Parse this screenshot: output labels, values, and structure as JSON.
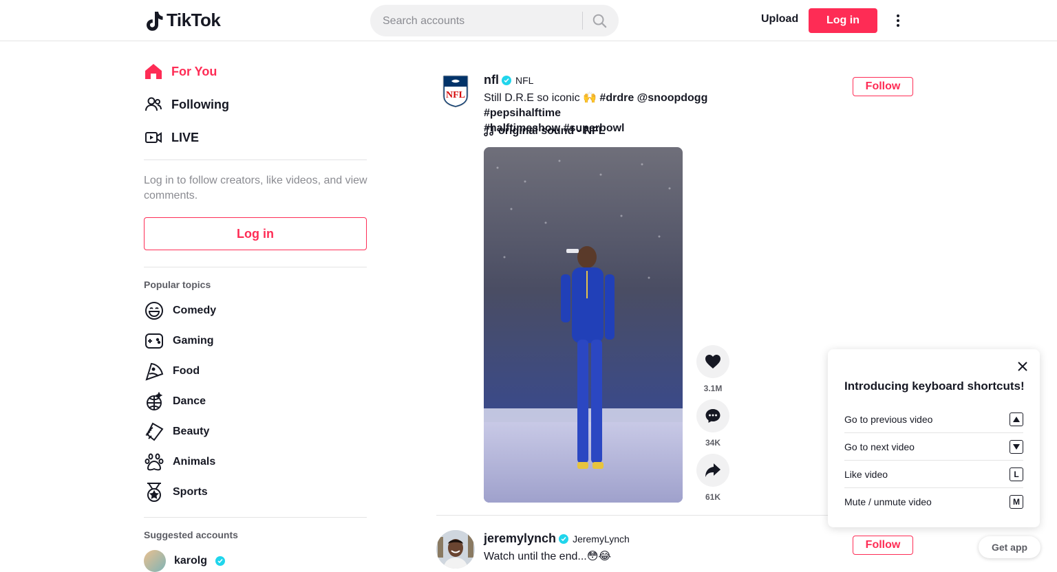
{
  "header": {
    "logo_text": "TikTok",
    "search_placeholder": "Search accounts",
    "upload_label": "Upload",
    "login_label": "Log in"
  },
  "sidebar": {
    "nav": [
      {
        "label": "For You",
        "icon": "home-icon",
        "active": true
      },
      {
        "label": "Following",
        "icon": "users-icon",
        "active": false
      },
      {
        "label": "LIVE",
        "icon": "live-camera-icon",
        "active": false
      }
    ],
    "login_hint": "Log in to follow creators, like videos, and view comments.",
    "login_button": "Log in",
    "popular_topics_title": "Popular topics",
    "topics": [
      {
        "label": "Comedy",
        "icon": "laugh-icon"
      },
      {
        "label": "Gaming",
        "icon": "gamepad-icon"
      },
      {
        "label": "Food",
        "icon": "pizza-icon"
      },
      {
        "label": "Dance",
        "icon": "disco-ball-icon"
      },
      {
        "label": "Beauty",
        "icon": "comb-icon"
      },
      {
        "label": "Animals",
        "icon": "paw-icon"
      },
      {
        "label": "Sports",
        "icon": "medal-icon"
      }
    ],
    "suggested_title": "Suggested accounts",
    "suggested": [
      {
        "name": "karolg",
        "verified": true
      }
    ]
  },
  "feed": {
    "posts": [
      {
        "username": "nfl",
        "nickname": "NFL",
        "verified": true,
        "caption_text": "Still D.R.E so iconic 🙌",
        "tags_line1": "#drdre @snoopdogg #pepsihalftime",
        "tags_line2": "#halftimeshow #superbowl",
        "sound": "original sound - NFL",
        "follow_label": "Follow",
        "likes": "3.1M",
        "comments": "34K",
        "shares": "61K"
      },
      {
        "username": "jeremylynch",
        "nickname": "JeremyLynch",
        "verified": true,
        "caption_text": "Watch until the end...😳😂",
        "follow_label": "Follow"
      }
    ]
  },
  "shortcuts_popup": {
    "title": "Introducing keyboard shortcuts!",
    "rows": [
      {
        "label": "Go to previous video",
        "key": "▲"
      },
      {
        "label": "Go to next video",
        "key": "▼"
      },
      {
        "label": "Like video",
        "key": "L"
      },
      {
        "label": "Mute / unmute video",
        "key": "M"
      }
    ]
  },
  "get_app_label": "Get app",
  "colors": {
    "brand": "#fe2c55",
    "verified": "#20d5ec"
  }
}
